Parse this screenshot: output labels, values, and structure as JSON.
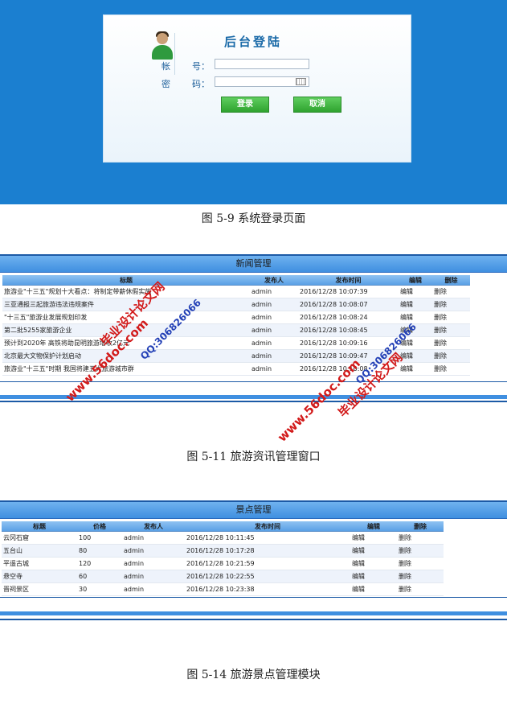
{
  "login": {
    "title": "后台登陆",
    "account_label_1": "帐",
    "account_label_2": "号：",
    "password_label_1": "密",
    "password_label_2": "码：",
    "login_button": "登录",
    "cancel_button": "取消"
  },
  "captions": {
    "fig_5_9": "图 5-9 系统登录页面",
    "fig_5_11": "图 5-11 旅游资讯管理窗口",
    "fig_5_14": "图 5-14 旅游景点管理模块"
  },
  "news": {
    "title": "新闻管理",
    "headers": [
      "标题",
      "发布人",
      "发布时间",
      "编辑",
      "删除"
    ],
    "rows": [
      [
        "旅游业\"十三五\"规划十大看点：将制定带薪休假实施",
        "admin",
        "2016/12/28 10:07:39",
        "编辑",
        "删除"
      ],
      [
        "三亚通报三起旅游违法违规案件",
        "admin",
        "2016/12/28 10:08:07",
        "编辑",
        "删除"
      ],
      [
        "\"十三五\"旅游业发展规划印发",
        "admin",
        "2016/12/28 10:08:24",
        "编辑",
        "删除"
      ],
      [
        "第二批5255家旅游企业",
        "admin",
        "2016/12/28 10:08:45",
        "编辑",
        "删除"
      ],
      [
        "预计到2020年 高铁将助昆明旅游增收2亿元",
        "admin",
        "2016/12/28 10:09:16",
        "编辑",
        "删除"
      ],
      [
        "北京最大文物保护计划启动",
        "admin",
        "2016/12/28 10:09:47",
        "编辑",
        "删除"
      ],
      [
        "旅游业\"十三五\"时期 我国将建五大旅游城市群",
        "admin",
        "2016/12/28 10:10:08",
        "编辑",
        "删除"
      ]
    ]
  },
  "spots": {
    "title": "景点管理",
    "headers": [
      "标题",
      "价格",
      "发布人",
      "发布时间",
      "编辑",
      "删除"
    ],
    "rows": [
      [
        "云冈石窟",
        "100",
        "admin",
        "2016/12/28 10:11:45",
        "编辑",
        "删除"
      ],
      [
        "五台山",
        "80",
        "admin",
        "2016/12/28 10:17:28",
        "编辑",
        "删除"
      ],
      [
        "平遥古城",
        "120",
        "admin",
        "2016/12/28 10:21:59",
        "编辑",
        "删除"
      ],
      [
        "悬空寺",
        "60",
        "admin",
        "2016/12/28 10:22:55",
        "编辑",
        "删除"
      ],
      [
        "晋祠景区",
        "30",
        "admin",
        "2016/12/28 10:23:38",
        "编辑",
        "删除"
      ]
    ]
  },
  "watermarks": {
    "site": "www.56doc.com",
    "brand": "毕业设计论文网",
    "qq": "QQ:306826066"
  }
}
